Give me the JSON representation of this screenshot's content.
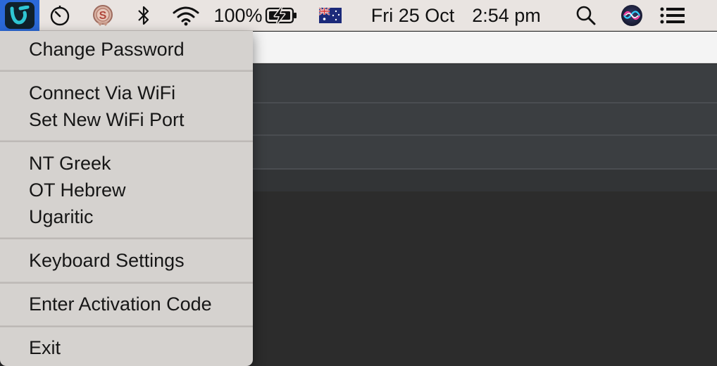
{
  "menubar": {
    "battery": "100%",
    "date": "Fri 25 Oct",
    "time": "2:54 pm",
    "icons": {
      "app": "app-logo-icon",
      "timer": "timer-icon",
      "app2": "s-badge-icon",
      "bluetooth": "bluetooth-icon",
      "wifi": "wifi-icon",
      "battery": "battery-charging-icon",
      "flag": "australia-flag-icon",
      "search": "search-icon",
      "siri": "siri-icon",
      "notifications": "list-icon"
    }
  },
  "menu": {
    "items": [
      "Change Password",
      "Connect Via WiFi",
      "Set New WiFi Port",
      "NT Greek",
      "OT Hebrew",
      "Ugaritic",
      "Keyboard Settings",
      "Enter Activation Code",
      "Exit"
    ]
  },
  "colors": {
    "menubar_bg": "#e9e4e1",
    "menu_bg": "#d5d2cf",
    "app_highlight": "#2b69d8",
    "dark_bg": "#2c2c2c"
  }
}
